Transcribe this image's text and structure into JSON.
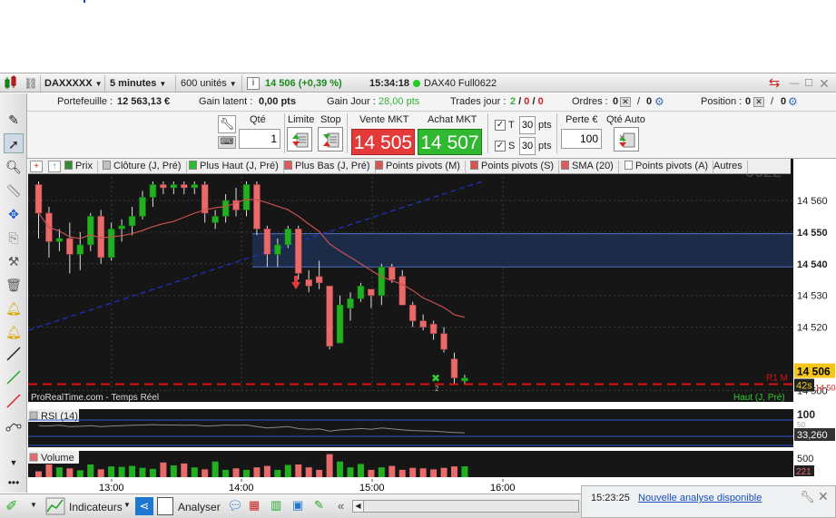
{
  "topbar": {
    "instrument": "DAXXXXX",
    "timeframe": "5 minutes",
    "units": "600 unités",
    "price_change": "14 506 (+0,39 %)",
    "time": "15:34:18",
    "contract": "DAX40 Full0622",
    "info_glyph": "i"
  },
  "info": {
    "portfolio_label": "Portefeuille :",
    "portfolio_value": "12 563,13 €",
    "latent_label": "Gain latent :",
    "latent_value": "0,00 pts",
    "gain_day_label": "Gain Jour :",
    "gain_day_value": "28,00 pts",
    "trades_label": "Trades jour :",
    "trades_a": "2",
    "trades_b": "0",
    "trades_c": "0",
    "orders_label": "Ordres :",
    "orders_a": "0",
    "orders_b": "0",
    "position_label": "Position :",
    "position_a": "0",
    "position_b": "0"
  },
  "order": {
    "qty_label": "Qté",
    "qty_value": "1",
    "limit_label": "Limite",
    "stop_label": "Stop",
    "sell_label": "Vente MKT",
    "sell_price": "14 505",
    "buy_label": "Achat MKT",
    "buy_price": "14 507",
    "t_label": "T",
    "t_value": "30",
    "s_label": "S",
    "s_value": "30",
    "pts": "pts",
    "perte_label": "Perte €",
    "perte_value": "100",
    "qty_auto_label": "Qté Auto"
  },
  "legend": [
    {
      "label": "Prix",
      "color": "#2e8b2e"
    },
    {
      "label": "Clôture (J, Pré)",
      "color": "#c0c0c0"
    },
    {
      "label": "Plus Haut (J, Pré)",
      "color": "#2eb82e"
    },
    {
      "label": "Plus Bas (J, Pré)",
      "color": "#e05a5a"
    },
    {
      "label": "Points pivots (M)",
      "color": "#d9534f"
    },
    {
      "label": "Points pivots (S)",
      "color": "#d9534f"
    },
    {
      "label": "SMA (20)",
      "color": "#e05a5a"
    },
    {
      "label": "Points pivots (A)",
      "color": "#ffffff"
    },
    {
      "label": "Autres",
      "color": ""
    }
  ],
  "chart": {
    "watermark": "0622",
    "source": "ProRealTime.com - Temps Réel",
    "haut_label": "Haut (J, Pré)",
    "r1_label": "R1 M",
    "current_price": "14 506",
    "countdown": "42s",
    "hidden_price": "14 504",
    "marker_count": "2",
    "rsi_label": "RSI (14)",
    "rsi_top": "100",
    "rsi_value": "33,260",
    "rsi_hidden": "50",
    "volume_label": "Volume",
    "volume_top": "500",
    "volume_value": "221",
    "colors": {
      "up": "#22b022",
      "down": "#e86a6a",
      "r1": "#e01010",
      "sma": "#c85050",
      "trend": "#2030c0",
      "zone": "#1c2c48"
    }
  },
  "chart_data": {
    "type": "candlestick",
    "y_ticks": [
      14560,
      14550,
      14540,
      14530,
      14520,
      14500
    ],
    "bold_ticks": [
      14550,
      14540
    ],
    "ylim": [
      14497,
      14566
    ],
    "x_ticks": [
      "13:00",
      "14:00",
      "15:00",
      "16:00"
    ],
    "r1": 14502,
    "zone": [
      14539,
      14549.5
    ],
    "last": 14506,
    "candles": [
      {
        "o": 14565,
        "h": 14566,
        "l": 14548,
        "c": 14556
      },
      {
        "o": 14556,
        "h": 14558,
        "l": 14542,
        "c": 14547
      },
      {
        "o": 14547,
        "h": 14551,
        "l": 14544,
        "c": 14548
      },
      {
        "o": 14548,
        "h": 14553,
        "l": 14537,
        "c": 14543
      },
      {
        "o": 14543,
        "h": 14550,
        "l": 14538,
        "c": 14546
      },
      {
        "o": 14546,
        "h": 14556,
        "l": 14544,
        "c": 14555
      },
      {
        "o": 14555,
        "h": 14557,
        "l": 14540,
        "c": 14542
      },
      {
        "o": 14542,
        "h": 14553,
        "l": 14541,
        "c": 14551
      },
      {
        "o": 14551,
        "h": 14554,
        "l": 14547,
        "c": 14552
      },
      {
        "o": 14552,
        "h": 14558,
        "l": 14549,
        "c": 14555
      },
      {
        "o": 14555,
        "h": 14563,
        "l": 14554,
        "c": 14561
      },
      {
        "o": 14561,
        "h": 14566,
        "l": 14558,
        "c": 14565
      },
      {
        "o": 14565,
        "h": 14566,
        "l": 14562,
        "c": 14564
      },
      {
        "o": 14564,
        "h": 14566,
        "l": 14562,
        "c": 14565
      },
      {
        "o": 14565,
        "h": 14566,
        "l": 14562,
        "c": 14564
      },
      {
        "o": 14564,
        "h": 14566,
        "l": 14562,
        "c": 14565
      },
      {
        "o": 14565,
        "h": 14566,
        "l": 14553,
        "c": 14556
      },
      {
        "o": 14553,
        "h": 14557,
        "l": 14551,
        "c": 14555
      },
      {
        "o": 14555,
        "h": 14562,
        "l": 14553,
        "c": 14560
      },
      {
        "o": 14560,
        "h": 14564,
        "l": 14555,
        "c": 14557
      },
      {
        "o": 14557,
        "h": 14566,
        "l": 14555,
        "c": 14565
      },
      {
        "o": 14565,
        "h": 14566,
        "l": 14549,
        "c": 14551
      },
      {
        "o": 14551,
        "h": 14552,
        "l": 14539,
        "c": 14543
      },
      {
        "o": 14543,
        "h": 14548,
        "l": 14539,
        "c": 14546
      },
      {
        "o": 14546,
        "h": 14552,
        "l": 14545,
        "c": 14551
      },
      {
        "o": 14551,
        "h": 14552,
        "l": 14535,
        "c": 14537
      },
      {
        "o": 14535,
        "h": 14538,
        "l": 14531,
        "c": 14533
      },
      {
        "o": 14536,
        "h": 14541,
        "l": 14532,
        "c": 14534
      },
      {
        "o": 14533,
        "h": 14533,
        "l": 14513,
        "c": 14514
      },
      {
        "o": 14515,
        "h": 14530,
        "l": 14515,
        "c": 14527
      },
      {
        "o": 14526,
        "h": 14531,
        "l": 14522,
        "c": 14529
      },
      {
        "o": 14529,
        "h": 14534,
        "l": 14528,
        "c": 14533
      },
      {
        "o": 14532,
        "h": 14532,
        "l": 14526,
        "c": 14530
      },
      {
        "o": 14530,
        "h": 14540,
        "l": 14527,
        "c": 14539
      },
      {
        "o": 14539,
        "h": 14540,
        "l": 14534,
        "c": 14535
      },
      {
        "o": 14536,
        "h": 14538,
        "l": 14527,
        "c": 14527
      },
      {
        "o": 14527,
        "h": 14528,
        "l": 14520,
        "c": 14522
      },
      {
        "o": 14522,
        "h": 14524,
        "l": 14519,
        "c": 14520
      },
      {
        "o": 14521,
        "h": 14522,
        "l": 14516,
        "c": 14518
      },
      {
        "o": 14518,
        "h": 14520,
        "l": 14512,
        "c": 14513
      },
      {
        "o": 14510,
        "h": 14512,
        "l": 14502,
        "c": 14504
      },
      {
        "o": 14503,
        "h": 14505,
        "l": 14502,
        "c": 14504
      }
    ],
    "rsi": [
      55,
      54,
      56,
      52,
      53,
      55,
      52,
      54,
      55,
      56,
      57,
      58,
      57,
      57,
      56,
      57,
      54,
      55,
      57,
      56,
      57,
      52,
      48,
      50,
      52,
      46,
      44,
      45,
      38,
      42,
      44,
      46,
      44,
      48,
      45,
      42,
      40,
      39,
      38,
      36,
      34,
      33
    ],
    "volume": [
      120,
      260,
      200,
      180,
      140,
      260,
      160,
      220,
      210,
      230,
      190,
      170,
      300,
      240,
      280,
      200,
      160,
      320,
      150,
      180,
      150,
      200,
      230,
      150,
      250,
      260,
      200,
      150,
      470,
      320,
      200,
      270,
      150,
      200,
      230,
      150,
      190,
      180,
      160,
      190,
      220,
      221
    ]
  },
  "bottom": {
    "indicators_label": "Indicateurs",
    "analyser_label": "Analyser"
  },
  "notification": {
    "time": "15:23:25",
    "link": "Nouvelle analyse disponible"
  }
}
